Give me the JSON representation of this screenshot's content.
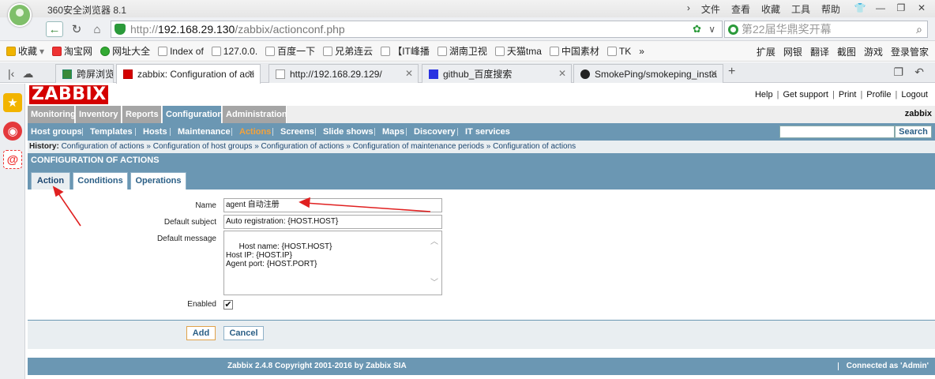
{
  "browser": {
    "title": "360安全浏览器 8.1",
    "menus": [
      "文件",
      "查看",
      "收藏",
      "工具",
      "帮助"
    ],
    "url": {
      "proto": "http://",
      "host": "192.168.29.130",
      "rest": "/zabbix/actionconf.php"
    },
    "search_placeholder": "第22届华鼎奖开幕",
    "bookmarks": [
      {
        "label": "收藏",
        "icon": "star-icon"
      },
      {
        "label": "淘宝网",
        "icon": "taobao-icon"
      },
      {
        "label": "网址大全",
        "icon": "globe-icon"
      },
      {
        "label": "Index of",
        "icon": "page-icon"
      },
      {
        "label": "127.0.0.",
        "icon": "page-icon"
      },
      {
        "label": "百度一下",
        "icon": "page-icon"
      },
      {
        "label": "兄弟连云",
        "icon": "page-icon"
      },
      {
        "label": "【IT峰播",
        "icon": "page-icon"
      },
      {
        "label": "湖南卫视",
        "icon": "tv-icon"
      },
      {
        "label": "天猫tma",
        "icon": "page-icon"
      },
      {
        "label": "中国素材",
        "icon": "page-icon"
      },
      {
        "label": "TK",
        "icon": "page-icon"
      },
      {
        "label": "»",
        "icon": ""
      }
    ],
    "bookmarks_right": [
      "扩展",
      "网银",
      "翻译",
      "截图",
      "游戏",
      "登录管家"
    ],
    "tabs": [
      {
        "label": "跨屏浏览"
      },
      {
        "label": "zabbix: Configuration of acti"
      },
      {
        "label": "http://192.168.29.129/"
      },
      {
        "label": "github_百度搜索"
      },
      {
        "label": "SmokePing/smokeping_insta"
      }
    ]
  },
  "zabbix": {
    "logo": "ZABBIX",
    "toplinks": [
      "Help",
      "Get support",
      "Print",
      "Profile",
      "Logout"
    ],
    "main_menu": [
      "Monitoring",
      "Inventory",
      "Reports",
      "Configuration",
      "Administration"
    ],
    "username": "zabbix",
    "sub_menu": [
      "Host groups",
      "Templates",
      "Hosts",
      "Maintenance",
      "Actions",
      "Screens",
      "Slide shows",
      "Maps",
      "Discovery",
      "IT services"
    ],
    "search_button": "Search",
    "history_label": "History:",
    "history": [
      "Configuration of actions",
      "Configuration of host groups",
      "Configuration of actions",
      "Configuration of maintenance periods",
      "Configuration of actions"
    ],
    "page_title": "CONFIGURATION OF ACTIONS",
    "form_tabs": [
      "Action",
      "Conditions",
      "Operations"
    ],
    "form": {
      "name_label": "Name",
      "name_value": "agent 自动注册",
      "subject_label": "Default subject",
      "subject_value": "Auto registration: {HOST.HOST}",
      "message_label": "Default message",
      "message_value": "Host name: {HOST.HOST}\nHost IP: {HOST.IP}\nAgent port: {HOST.PORT}",
      "enabled_label": "Enabled",
      "enabled_checked": "✔"
    },
    "buttons": {
      "add": "Add",
      "cancel": "Cancel"
    },
    "footer": {
      "copyright": "Zabbix 2.4.8 Copyright 2001-2016 by Zabbix SIA",
      "connected": "Connected as 'Admin'"
    }
  },
  "colors": {
    "zabbix_red": "#d40000",
    "zabbix_blue": "#6b97b3",
    "annotation_red": "#e02020"
  }
}
